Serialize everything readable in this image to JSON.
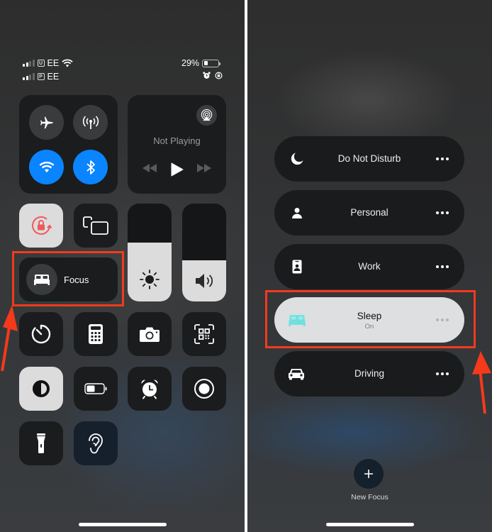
{
  "left": {
    "status": {
      "line1": {
        "sim": "U",
        "carrier": "EE",
        "battery_text": "29%",
        "battery_level": 0.29
      },
      "line2": {
        "sim": "P",
        "carrier": "EE"
      },
      "icons": [
        "signal-icon",
        "wifi-icon",
        "battery-icon",
        "alarm-icon",
        "orientation-lock-icon"
      ]
    },
    "connectivity": {
      "airplane": {
        "icon": "airplane-icon",
        "on": false
      },
      "cellular": {
        "icon": "antenna-icon",
        "on": false
      },
      "wifi": {
        "icon": "wifi-icon",
        "on": true
      },
      "bluetooth": {
        "icon": "bluetooth-icon",
        "on": true
      }
    },
    "media": {
      "title": "Not Playing",
      "airplay_icon": "airplay-icon",
      "controls": [
        "rewind-icon",
        "play-icon",
        "fast-forward-icon"
      ]
    },
    "orientation_lock": {
      "icon": "orientation-lock-icon",
      "on": true
    },
    "screen_mirroring": {
      "icon": "screen-mirroring-icon"
    },
    "focus": {
      "label": "Focus",
      "icon": "bed-icon"
    },
    "brightness": {
      "icon": "sun-icon",
      "level": 0.6
    },
    "volume": {
      "icon": "speaker-icon",
      "level": 0.42
    },
    "grid": [
      {
        "name": "timer",
        "icon": "timer-icon"
      },
      {
        "name": "calculator",
        "icon": "calculator-icon"
      },
      {
        "name": "camera",
        "icon": "camera-icon"
      },
      {
        "name": "code-scanner",
        "icon": "qr-code-icon"
      },
      {
        "name": "dark-mode",
        "icon": "dark-mode-icon",
        "on": true
      },
      {
        "name": "low-power-mode",
        "icon": "battery-icon"
      },
      {
        "name": "alarm",
        "icon": "alarm-icon"
      },
      {
        "name": "screen-recording",
        "icon": "record-icon"
      },
      {
        "name": "flashlight",
        "icon": "flashlight-icon"
      },
      {
        "name": "hearing",
        "icon": "ear-icon"
      }
    ]
  },
  "right": {
    "focus_modes": [
      {
        "label": "Do Not Disturb",
        "icon": "moon-icon",
        "active": false
      },
      {
        "label": "Personal",
        "icon": "person-icon",
        "active": false
      },
      {
        "label": "Work",
        "icon": "id-badge-icon",
        "active": false
      },
      {
        "label": "Sleep",
        "sublabel": "On",
        "icon": "bed-icon",
        "active": true
      },
      {
        "label": "Driving",
        "icon": "car-icon",
        "active": false
      }
    ],
    "new_focus_label": "New Focus"
  },
  "colors": {
    "accent_blue": "#0a84ff",
    "annotation_red": "#f43a1b",
    "sleep_teal": "#6fe0df",
    "orientation_red": "#ef5a5a"
  }
}
